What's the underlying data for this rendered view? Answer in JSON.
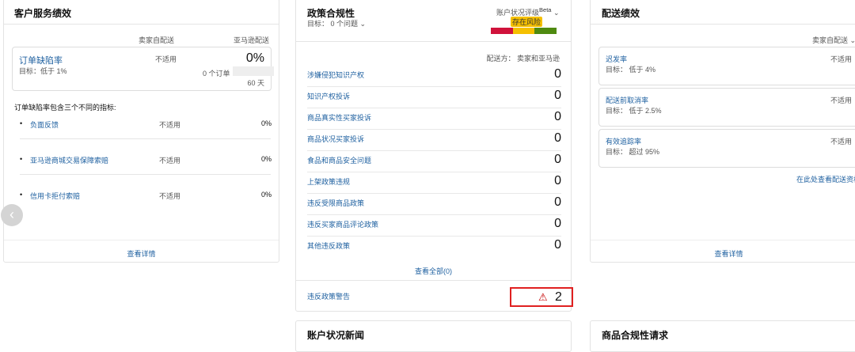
{
  "customer_service": {
    "title": "客户服务绩效",
    "col_seller": "卖家自配送",
    "col_amazon": "亚马逊配送",
    "odr": {
      "label": "订单缺陷率",
      "target": "目标：低于 1%",
      "seller_value": "不适用",
      "amazon_value": "0%",
      "orders": "0 个订单",
      "days": "60 天"
    },
    "intro": "订单缺陷率包含三个不同的指标:",
    "metrics": [
      {
        "label": "负面反馈",
        "seller": "不适用",
        "amazon": "0%"
      },
      {
        "label": "亚马逊商城交易保障索赔",
        "seller": "不适用",
        "amazon": "0%"
      },
      {
        "label": "信用卡拒付索赔",
        "seller": "不适用",
        "amazon": "0%"
      }
    ],
    "details_link": "查看详情"
  },
  "policy": {
    "title": "政策合规性",
    "target": "目标：  0 个问题",
    "rating_label": "账户状况评级",
    "beta": "Beta",
    "rating_status": "存在风险",
    "rating_colors": [
      "#d0123b",
      "#f5c000",
      "#4f8a10"
    ],
    "fulfilled_by": "配送方：  卖家和亚马逊",
    "rows": [
      {
        "label": "涉嫌侵犯知识产权",
        "value": "0"
      },
      {
        "label": "知识产权投诉",
        "value": "0"
      },
      {
        "label": "商品真实性买家投诉",
        "value": "0"
      },
      {
        "label": "商品状况买家投诉",
        "value": "0"
      },
      {
        "label": "食品和商品安全问题",
        "value": "0"
      },
      {
        "label": "上架政策违规",
        "value": "0"
      },
      {
        "label": "违反受限商品政策",
        "value": "0"
      },
      {
        "label": "违反买家商品评论政策",
        "value": "0"
      },
      {
        "label": "其他违反政策",
        "value": "0"
      }
    ],
    "view_all": "查看全部(0)",
    "warning_label": "违反政策警告",
    "warning_count": "2"
  },
  "shipping": {
    "title": "配送绩效",
    "selector": "卖家自配送",
    "metrics": [
      {
        "label": "迟发率",
        "target": "目标：  低于 4%",
        "value": "不适用"
      },
      {
        "label": "配送前取消率",
        "target": "目标：  低于 2.5%",
        "value": "不适用"
      },
      {
        "label": "有效追踪率",
        "target": "目标：  超过 95%",
        "value": "不适用"
      }
    ],
    "eligibility_link": "在此处查看配送资格",
    "details_link": "查看详情"
  },
  "news": {
    "title": "账户状况新闻"
  },
  "compliance": {
    "title": "商品合规性请求"
  }
}
